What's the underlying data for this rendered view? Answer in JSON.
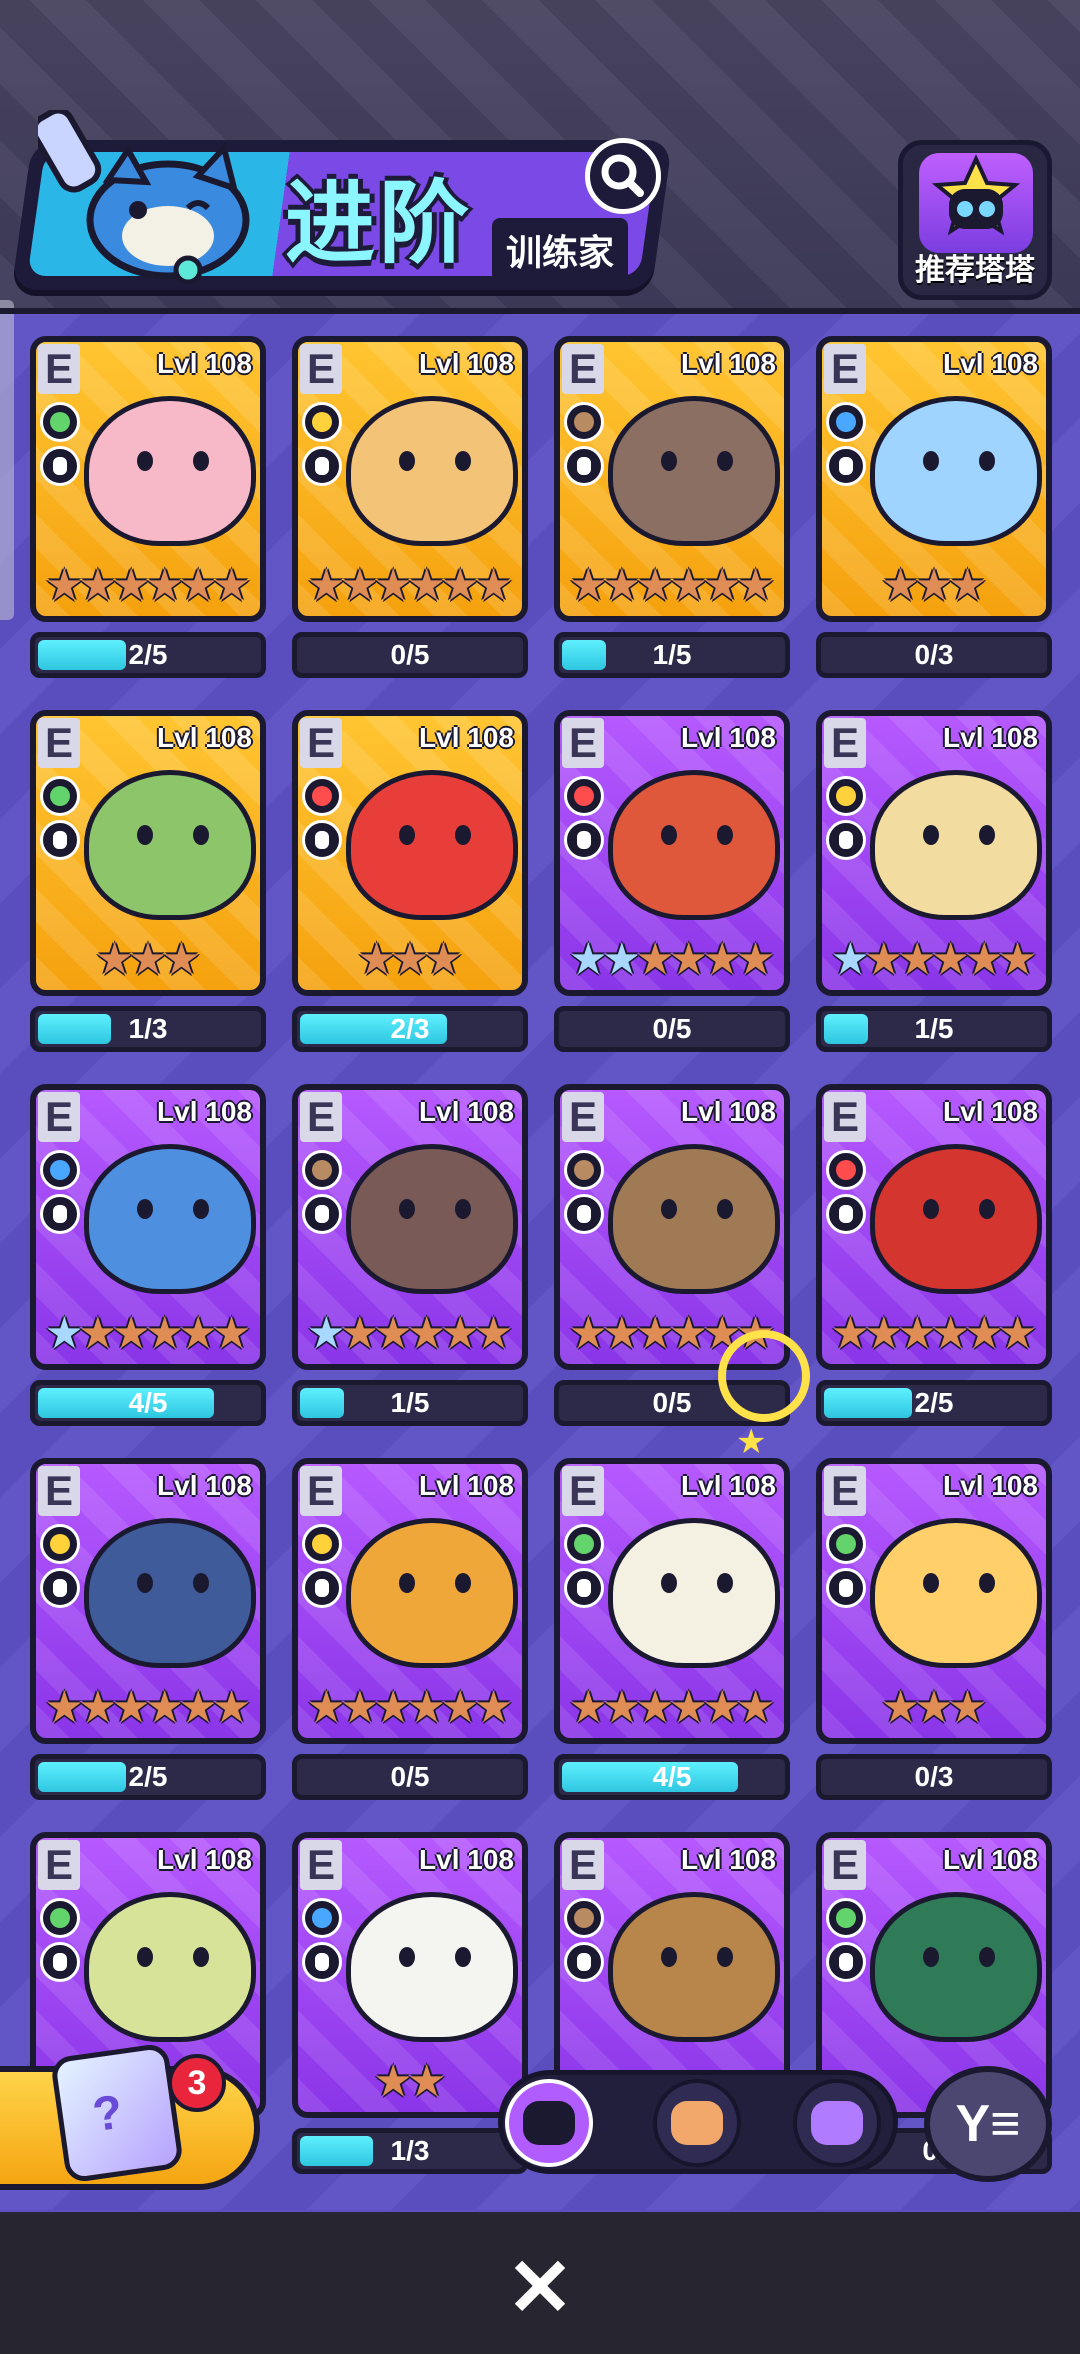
{
  "header": {
    "title": "进阶",
    "subtitle": "训练家",
    "search_icon": "search-icon",
    "recommend_label": "推荐塔塔"
  },
  "cards": [
    {
      "rank": "E",
      "level": "Lvl 108",
      "bg": "gold",
      "element": "#63d36b",
      "stars_blue": 0,
      "stars_orange": 6,
      "progress": "2/5",
      "fill": 0.4,
      "body": "#f7b9c8"
    },
    {
      "rank": "E",
      "level": "Lvl 108",
      "bg": "gold",
      "element": "#ffd23c",
      "stars_blue": 0,
      "stars_orange": 6,
      "progress": "0/5",
      "fill": 0,
      "body": "#f3c477"
    },
    {
      "rank": "E",
      "level": "Lvl 108",
      "bg": "gold",
      "element": "#b88b62",
      "stars_blue": 0,
      "stars_orange": 6,
      "progress": "1/5",
      "fill": 0.2,
      "body": "#8a6f62"
    },
    {
      "rank": "E",
      "level": "Lvl 108",
      "bg": "gold",
      "element": "#49a7ff",
      "stars_blue": 0,
      "stars_orange": 3,
      "progress": "0/3",
      "fill": 0,
      "body": "#9ed4ff"
    },
    {
      "rank": "E",
      "level": "Lvl 108",
      "bg": "gold",
      "element": "#63d36b",
      "stars_blue": 0,
      "stars_orange": 3,
      "progress": "1/3",
      "fill": 0.33,
      "body": "#8cc56a"
    },
    {
      "rank": "E",
      "level": "Lvl 108",
      "bg": "gold",
      "element": "#ff4c4c",
      "stars_blue": 0,
      "stars_orange": 3,
      "progress": "2/3",
      "fill": 0.67,
      "body": "#e83e3a"
    },
    {
      "rank": "E",
      "level": "Lvl 108",
      "bg": "purple",
      "element": "#ff4c4c",
      "stars_blue": 2,
      "stars_orange": 4,
      "progress": "0/5",
      "fill": 0,
      "body": "#e0583b"
    },
    {
      "rank": "E",
      "level": "Lvl 108",
      "bg": "purple",
      "element": "#ffd23c",
      "stars_blue": 1,
      "stars_orange": 5,
      "progress": "1/5",
      "fill": 0.2,
      "body": "#f2dca0"
    },
    {
      "rank": "E",
      "level": "Lvl 108",
      "bg": "purple",
      "element": "#49a7ff",
      "stars_blue": 1,
      "stars_orange": 5,
      "progress": "4/5",
      "fill": 0.8,
      "body": "#4f8fe0"
    },
    {
      "rank": "E",
      "level": "Lvl 108",
      "bg": "purple",
      "element": "#b88b62",
      "stars_blue": 1,
      "stars_orange": 5,
      "progress": "1/5",
      "fill": 0.2,
      "body": "#7a5a56"
    },
    {
      "rank": "E",
      "level": "Lvl 108",
      "bg": "purple",
      "element": "#b88b62",
      "stars_blue": 0,
      "stars_orange": 6,
      "progress": "0/5",
      "fill": 0,
      "body": "#a07a55"
    },
    {
      "rank": "E",
      "level": "Lvl 108",
      "bg": "purple",
      "element": "#ff4c4c",
      "stars_blue": 0,
      "stars_orange": 6,
      "progress": "2/5",
      "fill": 0.4,
      "body": "#d4352f"
    },
    {
      "rank": "E",
      "level": "Lvl 108",
      "bg": "purple",
      "element": "#ffd23c",
      "stars_blue": 0,
      "stars_orange": 6,
      "progress": "2/5",
      "fill": 0.4,
      "body": "#3f5b9a"
    },
    {
      "rank": "E",
      "level": "Lvl 108",
      "bg": "purple",
      "element": "#ffd23c",
      "stars_blue": 0,
      "stars_orange": 6,
      "progress": "0/5",
      "fill": 0,
      "body": "#f0a73a"
    },
    {
      "rank": "E",
      "level": "Lvl 108",
      "bg": "purple",
      "element": "#63d36b",
      "stars_blue": 0,
      "stars_orange": 6,
      "progress": "4/5",
      "fill": 0.8,
      "body": "#f4f1e2"
    },
    {
      "rank": "E",
      "level": "Lvl 108",
      "bg": "purple",
      "element": "#63d36b",
      "stars_blue": 0,
      "stars_orange": 3,
      "progress": "0/3",
      "fill": 0,
      "body": "#ffd06a"
    },
    {
      "rank": "E",
      "level": "Lvl 108",
      "bg": "purple",
      "element": "#63d36b",
      "stars_blue": 0,
      "stars_orange": 0,
      "progress": "",
      "fill": 0,
      "body": "#d8e39a"
    },
    {
      "rank": "E",
      "level": "Lvl 108",
      "bg": "purple",
      "element": "#49a7ff",
      "stars_blue": 0,
      "stars_orange": 2,
      "progress": "1/3",
      "fill": 0.33,
      "body": "#f4f4f0"
    },
    {
      "rank": "E",
      "level": "Lvl 108",
      "bg": "purple",
      "element": "#b88b62",
      "stars_blue": 0,
      "stars_orange": 0,
      "progress": "",
      "fill": 0,
      "body": "#b8864a"
    },
    {
      "rank": "E",
      "level": "Lvl 108",
      "bg": "purple",
      "element": "#63d36b",
      "stars_blue": 0,
      "stars_orange": 0,
      "progress": "0/",
      "fill": 0,
      "body": "#2f7b57"
    }
  ],
  "gift": {
    "label": "?",
    "badge": "3"
  },
  "dock": {
    "tabs": [
      "tata-tab",
      "pet-tab",
      "rare-tab"
    ]
  },
  "close_label": "✕"
}
